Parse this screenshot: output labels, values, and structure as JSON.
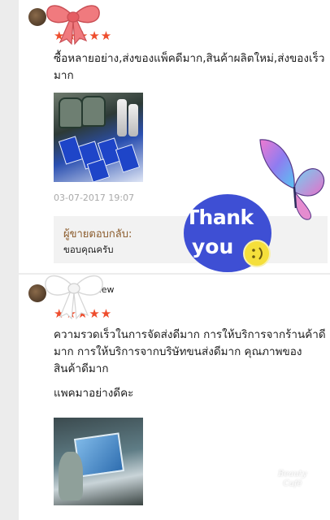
{
  "colors": {
    "rating_star": "#ee4d2d",
    "seller_title": "#8a5a2a",
    "sticker_blue": "#3e4fd4",
    "smiley_yellow": "#f5df3b"
  },
  "reviews": [
    {
      "username": "",
      "rating": 5,
      "stars_text": "★★★★★",
      "text": "ซื้อหลายอย่าง,ส่งของแพ็คดีมาก,สินค้าผลิตใหม่,ส่งของเร็วมาก",
      "timestamp": "03-07-2017 19:07",
      "seller_reply": {
        "title": "ผู้ขายตอบกลับ:",
        "text": "ขอบคุณครับ"
      }
    },
    {
      "username": "aew",
      "rating": 5,
      "stars_text": "★★★★★",
      "text": "ความรวดเร็วในการจัดส่งดีมาก การให้บริการจากร้านค้าดีมาก การให้บริการจากบริษัทขนส่งดีมาก คุณภาพของสินค้าดีมาก",
      "text2": "แพคมาอย่างดีคะ"
    }
  ],
  "stickers": {
    "thank_line1": "Thank",
    "thank_line2": "you",
    "smiley": ":)",
    "icons": [
      "bow-sticker-pink",
      "bow-sticker-white",
      "butterfly-sticker",
      "thank-you-sticker"
    ]
  }
}
